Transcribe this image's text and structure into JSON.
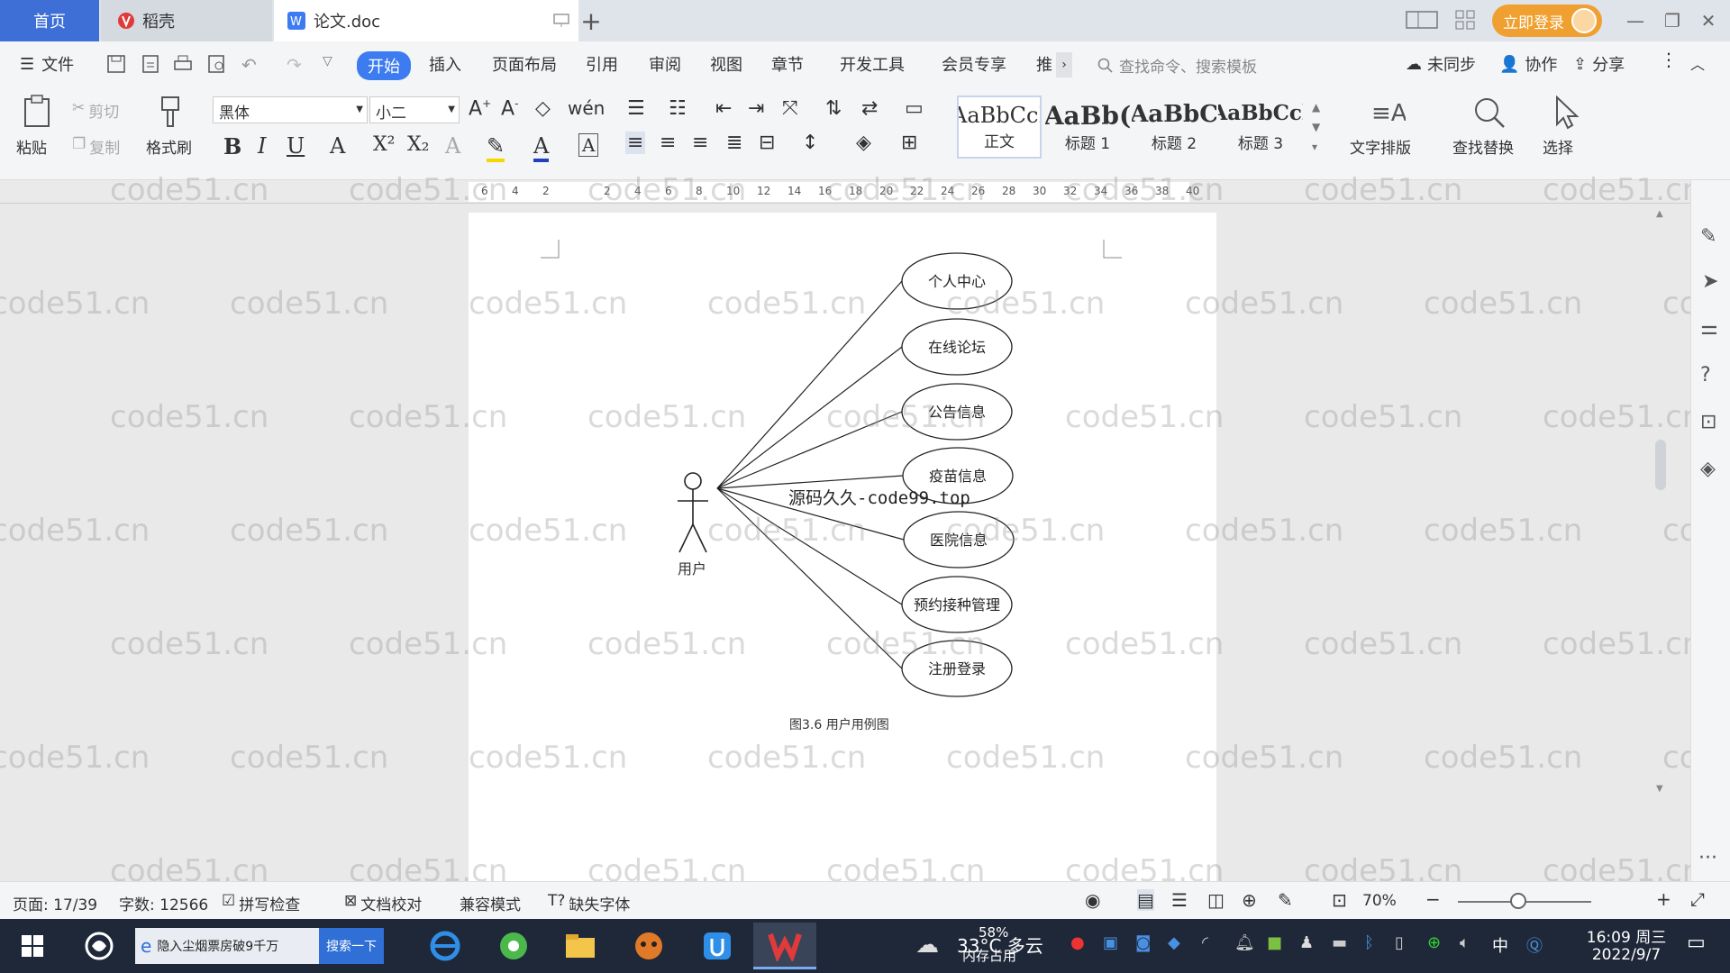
{
  "tabs": {
    "home": "首页",
    "daoke": "稻壳",
    "doc": "论文.doc"
  },
  "titlebar": {
    "login": "立即登录"
  },
  "menu": {
    "file": "文件",
    "items": [
      "开始",
      "插入",
      "页面布局",
      "引用",
      "审阅",
      "视图",
      "章节",
      "开发工具",
      "会员专享",
      "推"
    ],
    "search": "查找命令、搜索模板",
    "sync": "未同步",
    "collab": "协作",
    "share": "分享"
  },
  "ribbon": {
    "paste": "粘贴",
    "cut": "剪切",
    "copy": "复制",
    "format_painter": "格式刷",
    "font": "黑体",
    "size": "小二",
    "styles": [
      {
        "preview": "AaBbCcI",
        "name": "正文"
      },
      {
        "preview": "AaBb(",
        "name": "标题 1"
      },
      {
        "preview": "AaBbC",
        "name": "标题 2"
      },
      {
        "preview": "AaBbCcl",
        "name": "标题 3"
      }
    ],
    "text_layout": "文字排版",
    "find_replace": "查找替换",
    "select": "选择"
  },
  "ruler": {
    "ticks": [
      "6",
      "4",
      "2",
      "",
      "2",
      "4",
      "6",
      "8",
      "10",
      "12",
      "14",
      "16",
      "18",
      "20",
      "22",
      "24",
      "26",
      "28",
      "30",
      "32",
      "34",
      "36",
      "38",
      "40"
    ]
  },
  "diagram": {
    "actor": "用户",
    "usecases": [
      "个人中心",
      "在线论坛",
      "公告信息",
      "疫苗信息",
      "医院信息",
      "预约接种管理",
      "注册登录"
    ],
    "caption": "图3.6 用户用例图",
    "overlay": "源码久久-code99.top"
  },
  "watermark": "code51.cn",
  "status": {
    "page": "页面: 17/39",
    "words": "字数: 12566",
    "spell": "拼写检查",
    "proof": "文档校对",
    "compat": "兼容模式",
    "missing_font": "缺失字体",
    "zoom": "70%"
  },
  "taskbar": {
    "news": "隐入尘烟票房破9千万",
    "search_btn": "搜索一下",
    "weather": "33°C 多云",
    "mem": "58%",
    "mem_label": "内存占用",
    "ime": "中",
    "time": "16:09 周三",
    "date": "2022/9/7"
  }
}
